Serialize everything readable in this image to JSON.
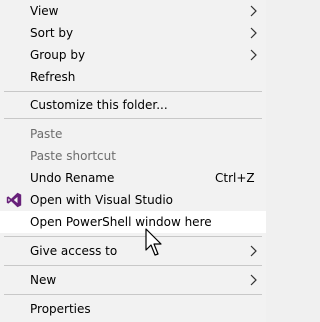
{
  "menu": {
    "items": [
      {
        "label": "View"
      },
      {
        "label": "Sort by"
      },
      {
        "label": "Group by"
      },
      {
        "label": "Refresh"
      },
      {
        "label": "Customize this folder..."
      },
      {
        "label": "Paste"
      },
      {
        "label": "Paste shortcut"
      },
      {
        "label": "Undo Rename",
        "shortcut": "Ctrl+Z"
      },
      {
        "label": "Open with Visual Studio"
      },
      {
        "label": "Open PowerShell window here"
      },
      {
        "label": "Give access to"
      },
      {
        "label": "New"
      },
      {
        "label": "Properties"
      }
    ]
  },
  "icons": {
    "submenu": "chevron-right-icon",
    "visual_studio": "visual-studio-icon",
    "cursor": "mouse-pointer-icon"
  },
  "colors": {
    "menu_bg": "#f2f2f2",
    "hover_bg": "#ffffff",
    "disabled_text": "#6d6d6d",
    "separator": "#c8c8c8",
    "vs_purple": "#68217a"
  }
}
